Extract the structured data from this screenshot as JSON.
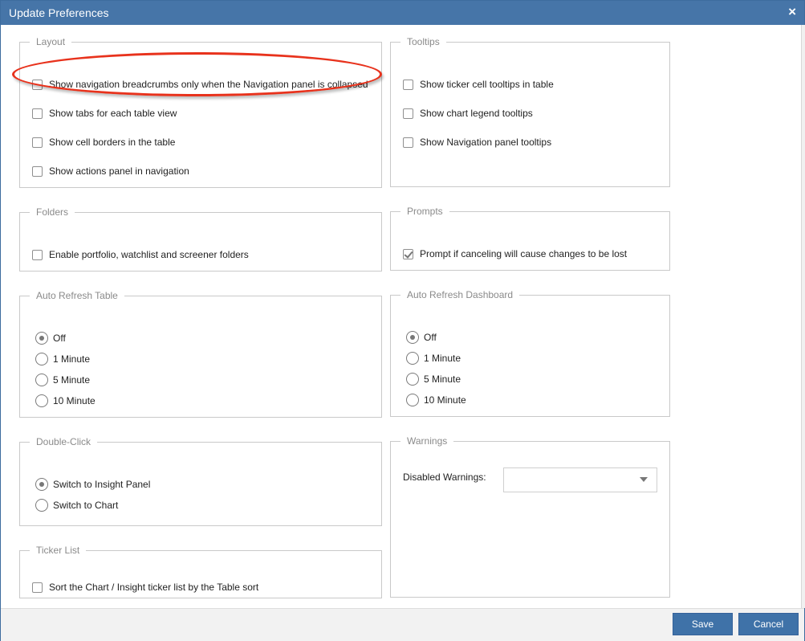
{
  "dialog": {
    "title": "Update Preferences",
    "close_icon": "×"
  },
  "layout_group": {
    "legend": "Layout",
    "options": [
      {
        "label": "Show navigation breadcrumbs only when the Navigation panel is collapsed",
        "checked": false
      },
      {
        "label": "Show tabs for each table view",
        "checked": false
      },
      {
        "label": "Show cell borders in the table",
        "checked": false
      },
      {
        "label": "Show actions panel in navigation",
        "checked": false
      }
    ]
  },
  "tooltips_group": {
    "legend": "Tooltips",
    "options": [
      {
        "label": "Show ticker cell tooltips in table",
        "checked": false
      },
      {
        "label": "Show chart legend tooltips",
        "checked": false
      },
      {
        "label": "Show Navigation panel tooltips",
        "checked": false
      }
    ]
  },
  "folders_group": {
    "legend": "Folders",
    "options": [
      {
        "label": "Enable portfolio, watchlist and screener folders",
        "checked": false
      }
    ]
  },
  "prompts_group": {
    "legend": "Prompts",
    "options": [
      {
        "label": "Prompt if canceling will cause changes to be lost",
        "checked": true
      }
    ]
  },
  "auto_refresh_table": {
    "legend": "Auto Refresh Table",
    "options": [
      "Off",
      "1 Minute",
      "5 Minute",
      "10 Minute"
    ],
    "selected": "Off"
  },
  "auto_refresh_dashboard": {
    "legend": "Auto Refresh Dashboard",
    "options": [
      "Off",
      "1 Minute",
      "5 Minute",
      "10 Minute"
    ],
    "selected": "Off"
  },
  "double_click_group": {
    "legend": "Double-Click",
    "options": [
      "Switch to Insight Panel",
      "Switch to Chart"
    ],
    "selected": "Switch to Insight Panel"
  },
  "warnings_group": {
    "legend": "Warnings",
    "disabled_label": "Disabled Warnings:",
    "disabled_value": "",
    "dropdown_icon": "chevron-down-icon"
  },
  "ticker_list_group": {
    "legend": "Ticker List",
    "options": [
      {
        "label": "Sort the Chart / Insight ticker list by the Table sort",
        "checked": false
      }
    ]
  },
  "footer": {
    "save_label": "Save",
    "cancel_label": "Cancel"
  },
  "colors": {
    "titlebar": "#4675a8",
    "button": "#3f72a8",
    "highlight": "#e8321c"
  }
}
